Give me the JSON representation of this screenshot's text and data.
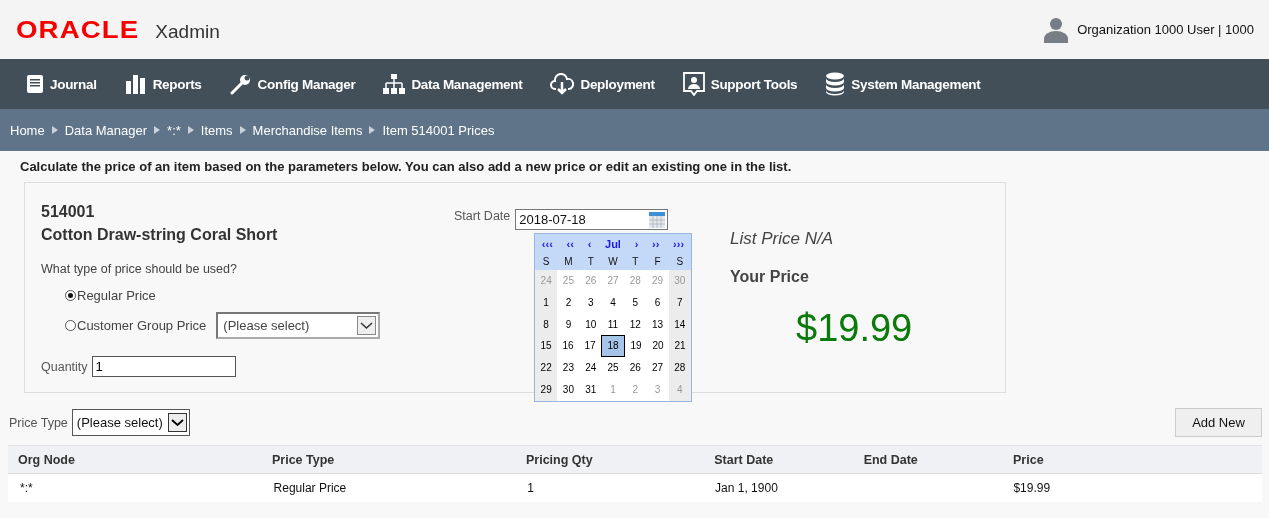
{
  "header": {
    "logo": "ORACLE",
    "app_name": "Xadmin",
    "user": "Organization 1000 User | 1000"
  },
  "nav": [
    {
      "label": "Journal"
    },
    {
      "label": "Reports"
    },
    {
      "label": "Config Manager"
    },
    {
      "label": "Data Management"
    },
    {
      "label": "Deployment"
    },
    {
      "label": "Support Tools"
    },
    {
      "label": "System Management"
    }
  ],
  "breadcrumb": [
    "Home",
    "Data Manager",
    "*:*",
    "Items",
    "Merchandise Items",
    "Item 514001 Prices"
  ],
  "intro": "Calculate the price of an item based on the parameters below. You can also add a new price or edit an existing one in the list.",
  "item": {
    "id": "514001",
    "name": "Cotton Draw-string Coral Short"
  },
  "price_question": "What type of price should be used?",
  "price_options": [
    {
      "label": "Regular Price",
      "selected": true
    },
    {
      "label": "Customer Group Price",
      "selected": false,
      "select": "(Please select)"
    }
  ],
  "quantity": {
    "label": "Quantity",
    "value": "1"
  },
  "start_date": {
    "label": "Start Date",
    "value": "2018-07-18"
  },
  "calendar": {
    "nav": [
      "‹‹‹",
      "‹‹",
      "‹",
      "Jul",
      "›",
      "››",
      "›››"
    ],
    "weekdays": [
      "S",
      "M",
      "T",
      "W",
      "T",
      "F",
      "S"
    ],
    "weeks": [
      [
        {
          "d": "24",
          "other_month": true,
          "selected": false
        },
        {
          "d": "25",
          "other_month": true,
          "selected": false
        },
        {
          "d": "26",
          "other_month": true,
          "selected": false
        },
        {
          "d": "27",
          "other_month": true,
          "selected": false
        },
        {
          "d": "28",
          "other_month": true,
          "selected": false
        },
        {
          "d": "29",
          "other_month": true,
          "selected": false
        },
        {
          "d": "30",
          "other_month": true,
          "selected": false
        }
      ],
      [
        {
          "d": "1",
          "other_month": false,
          "selected": false
        },
        {
          "d": "2",
          "other_month": false,
          "selected": false
        },
        {
          "d": "3",
          "other_month": false,
          "selected": false
        },
        {
          "d": "4",
          "other_month": false,
          "selected": false
        },
        {
          "d": "5",
          "other_month": false,
          "selected": false
        },
        {
          "d": "6",
          "other_month": false,
          "selected": false
        },
        {
          "d": "7",
          "other_month": false,
          "selected": false
        }
      ],
      [
        {
          "d": "8",
          "other_month": false,
          "selected": false
        },
        {
          "d": "9",
          "other_month": false,
          "selected": false
        },
        {
          "d": "10",
          "other_month": false,
          "selected": false
        },
        {
          "d": "11",
          "other_month": false,
          "selected": false
        },
        {
          "d": "12",
          "other_month": false,
          "selected": false
        },
        {
          "d": "13",
          "other_month": false,
          "selected": false
        },
        {
          "d": "14",
          "other_month": false,
          "selected": false
        }
      ],
      [
        {
          "d": "15",
          "other_month": false,
          "selected": false
        },
        {
          "d": "16",
          "other_month": false,
          "selected": false
        },
        {
          "d": "17",
          "other_month": false,
          "selected": false
        },
        {
          "d": "18",
          "other_month": false,
          "selected": true
        },
        {
          "d": "19",
          "other_month": false,
          "selected": false
        },
        {
          "d": "20",
          "other_month": false,
          "selected": false
        },
        {
          "d": "21",
          "other_month": false,
          "selected": false
        }
      ],
      [
        {
          "d": "22",
          "other_month": false,
          "selected": false
        },
        {
          "d": "23",
          "other_month": false,
          "selected": false
        },
        {
          "d": "24",
          "other_month": false,
          "selected": false
        },
        {
          "d": "25",
          "other_month": false,
          "selected": false
        },
        {
          "d": "26",
          "other_month": false,
          "selected": false
        },
        {
          "d": "27",
          "other_month": false,
          "selected": false
        },
        {
          "d": "28",
          "other_month": false,
          "selected": false
        }
      ],
      [
        {
          "d": "29",
          "other_month": false,
          "selected": false
        },
        {
          "d": "30",
          "other_month": false,
          "selected": false
        },
        {
          "d": "31",
          "other_month": false,
          "selected": false
        },
        {
          "d": "1",
          "other_month": true,
          "selected": false
        },
        {
          "d": "2",
          "other_month": true,
          "selected": false
        },
        {
          "d": "3",
          "other_month": true,
          "selected": false
        },
        {
          "d": "4",
          "other_month": true,
          "selected": false
        }
      ]
    ]
  },
  "list_price": "List Price N/A",
  "your_price": {
    "label": "Your Price",
    "value": "$19.99"
  },
  "price_type_filter": {
    "label": "Price Type",
    "select": "(Please select)"
  },
  "add_button": "Add New",
  "table": {
    "columns": [
      "Org Node",
      "Price Type",
      "Pricing Qty",
      "Start Date",
      "End Date",
      "Price"
    ],
    "rows": [
      [
        "*:*",
        "Regular Price",
        "1",
        "Jan 1, 1900",
        "",
        "$19.99"
      ]
    ]
  }
}
